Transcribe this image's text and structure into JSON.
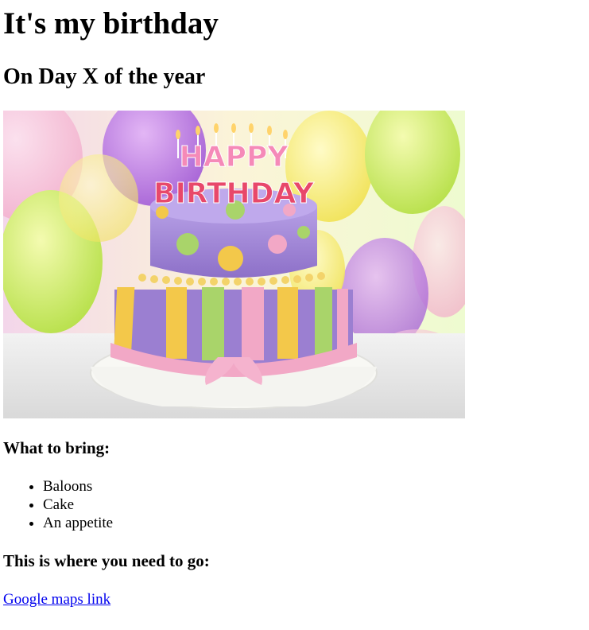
{
  "page": {
    "title": "It's my birthday",
    "subtitle": "On Day X of the year"
  },
  "hero": {
    "candle_text_top": "HAPPY",
    "candle_text_bottom": "BIRTHDAY"
  },
  "bring": {
    "heading": "What to bring:",
    "items": [
      "Baloons",
      "Cake",
      "An appetite"
    ]
  },
  "directions": {
    "heading": "This is where you need to go:",
    "link_label": "Google maps link"
  },
  "colors": {
    "link": "#0000ee",
    "cake_purple": "#9b7fd1",
    "ribbon_pink": "#f2a8c6",
    "stripe_yellow": "#f3c84a",
    "stripe_green": "#a9d46a"
  }
}
